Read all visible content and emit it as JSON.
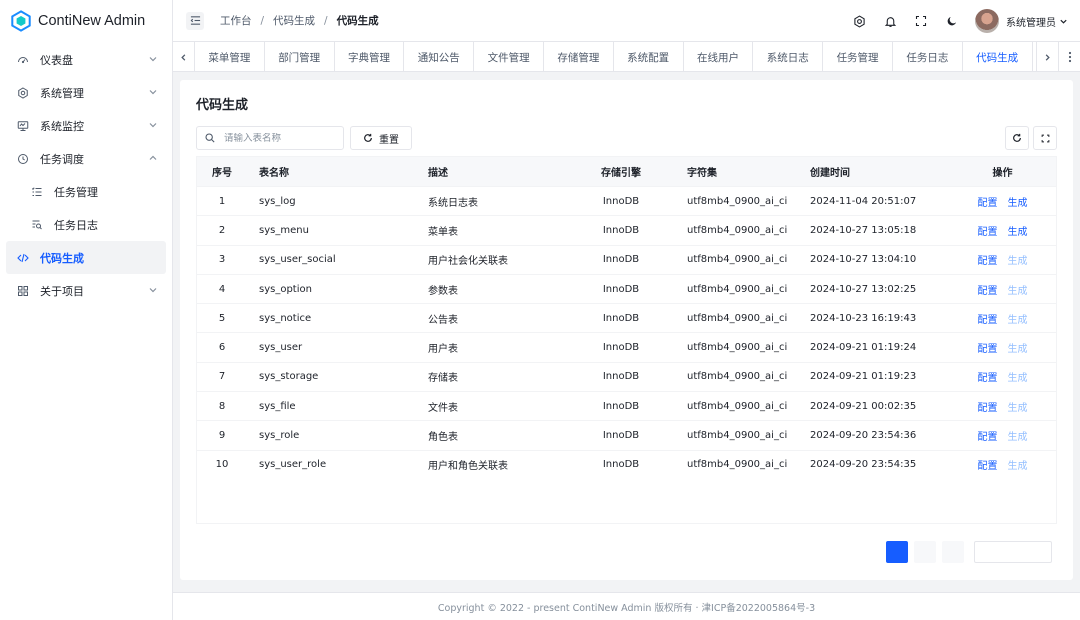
{
  "app": {
    "title": "ContiNew Admin",
    "brand_color": "#165dff"
  },
  "sidebar": {
    "items": [
      {
        "label": "仪表盘",
        "icon": "dashboard-icon",
        "expandable": true
      },
      {
        "label": "系统管理",
        "icon": "settings-icon",
        "expandable": true
      },
      {
        "label": "系统监控",
        "icon": "monitor-icon",
        "expandable": true
      },
      {
        "label": "任务调度",
        "icon": "clock-icon",
        "expandable": true,
        "expanded": true
      },
      {
        "label": "任务管理",
        "icon": "list-icon",
        "sub": true
      },
      {
        "label": "任务日志",
        "icon": "log-search-icon",
        "sub": true
      },
      {
        "label": "代码生成",
        "icon": "code-icon",
        "active": true
      },
      {
        "label": "关于项目",
        "icon": "apps-icon",
        "expandable": true
      }
    ]
  },
  "header": {
    "breadcrumb": [
      "工作台",
      "代码生成",
      "代码生成"
    ],
    "username": "系统管理员"
  },
  "tabs": {
    "items": [
      "菜单管理",
      "部门管理",
      "字典管理",
      "通知公告",
      "文件管理",
      "存储管理",
      "系统配置",
      "在线用户",
      "系统日志",
      "任务管理",
      "任务日志",
      "代码生成"
    ],
    "active_index": 11
  },
  "page": {
    "title": "代码生成",
    "search_placeholder": "请输入表名称",
    "reset_label": "重置"
  },
  "table": {
    "columns": [
      "序号",
      "表名称",
      "描述",
      "存储引擎",
      "字符集",
      "创建时间",
      "操作"
    ],
    "action_config": "配置",
    "action_generate": "生成",
    "rows": [
      {
        "idx": "1",
        "name": "sys_log",
        "desc": "系统日志表",
        "engine": "InnoDB",
        "charset": "utf8mb4_0900_ai_ci",
        "time": "2024-11-04 20:51:07",
        "generate_enabled": true
      },
      {
        "idx": "2",
        "name": "sys_menu",
        "desc": "菜单表",
        "engine": "InnoDB",
        "charset": "utf8mb4_0900_ai_ci",
        "time": "2024-10-27 13:05:18",
        "generate_enabled": true
      },
      {
        "idx": "3",
        "name": "sys_user_social",
        "desc": "用户社会化关联表",
        "engine": "InnoDB",
        "charset": "utf8mb4_0900_ai_ci",
        "time": "2024-10-27 13:04:10",
        "generate_enabled": false
      },
      {
        "idx": "4",
        "name": "sys_option",
        "desc": "参数表",
        "engine": "InnoDB",
        "charset": "utf8mb4_0900_ai_ci",
        "time": "2024-10-27 13:02:25",
        "generate_enabled": false
      },
      {
        "idx": "5",
        "name": "sys_notice",
        "desc": "公告表",
        "engine": "InnoDB",
        "charset": "utf8mb4_0900_ai_ci",
        "time": "2024-10-23 16:19:43",
        "generate_enabled": false
      },
      {
        "idx": "6",
        "name": "sys_user",
        "desc": "用户表",
        "engine": "InnoDB",
        "charset": "utf8mb4_0900_ai_ci",
        "time": "2024-09-21 01:19:24",
        "generate_enabled": false
      },
      {
        "idx": "7",
        "name": "sys_storage",
        "desc": "存储表",
        "engine": "InnoDB",
        "charset": "utf8mb4_0900_ai_ci",
        "time": "2024-09-21 01:19:23",
        "generate_enabled": false
      },
      {
        "idx": "8",
        "name": "sys_file",
        "desc": "文件表",
        "engine": "InnoDB",
        "charset": "utf8mb4_0900_ai_ci",
        "time": "2024-09-21 00:02:35",
        "generate_enabled": false
      },
      {
        "idx": "9",
        "name": "sys_role",
        "desc": "角色表",
        "engine": "InnoDB",
        "charset": "utf8mb4_0900_ai_ci",
        "time": "2024-09-20 23:54:36",
        "generate_enabled": false
      },
      {
        "idx": "10",
        "name": "sys_user_role",
        "desc": "用户和角色关联表",
        "engine": "InnoDB",
        "charset": "utf8mb4_0900_ai_ci",
        "time": "2024-09-20 23:54:35",
        "generate_enabled": false
      }
    ]
  },
  "footer": {
    "text": "Copyright © 2022 - present ContiNew Admin 版权所有 · 津ICP备2022005864号-3"
  }
}
